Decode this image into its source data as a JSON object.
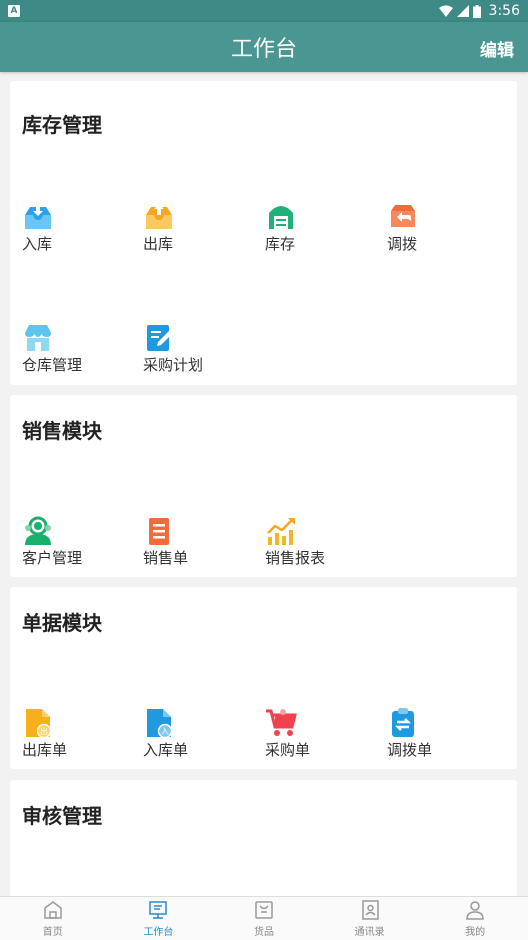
{
  "status": {
    "time": "3:56",
    "notif": "A"
  },
  "header": {
    "title": "工作台",
    "edit": "编辑"
  },
  "sections": [
    {
      "title": "库存管理",
      "items": [
        {
          "label": "入库",
          "icon": "inbox-in-icon"
        },
        {
          "label": "出库",
          "icon": "inbox-out-icon"
        },
        {
          "label": "库存",
          "icon": "warehouse-icon"
        },
        {
          "label": "调拨",
          "icon": "transfer-box-icon"
        },
        {
          "label": "仓库管理",
          "icon": "store-icon"
        },
        {
          "label": "采购计划",
          "icon": "edit-doc-icon"
        }
      ]
    },
    {
      "title": "销售模块",
      "items": [
        {
          "label": "客户管理",
          "icon": "customers-icon"
        },
        {
          "label": "销售单",
          "icon": "sales-doc-icon"
        },
        {
          "label": "销售报表",
          "icon": "chart-icon"
        }
      ]
    },
    {
      "title": "单据模块",
      "items": [
        {
          "label": "出库单",
          "icon": "out-doc-icon"
        },
        {
          "label": "入库单",
          "icon": "in-doc-icon"
        },
        {
          "label": "采购单",
          "icon": "cart-icon"
        },
        {
          "label": "调拨单",
          "icon": "transfer-doc-icon"
        }
      ]
    },
    {
      "title": "审核管理",
      "items": []
    }
  ],
  "tabs": [
    {
      "label": "首页",
      "icon": "home-icon"
    },
    {
      "label": "工作台",
      "icon": "workbench-icon"
    },
    {
      "label": "货品",
      "icon": "goods-icon"
    },
    {
      "label": "通讯录",
      "icon": "contacts-icon"
    },
    {
      "label": "我的",
      "icon": "profile-icon"
    }
  ],
  "colors": {
    "header": "#4a9692",
    "tab_active": "#2a8ac8"
  }
}
